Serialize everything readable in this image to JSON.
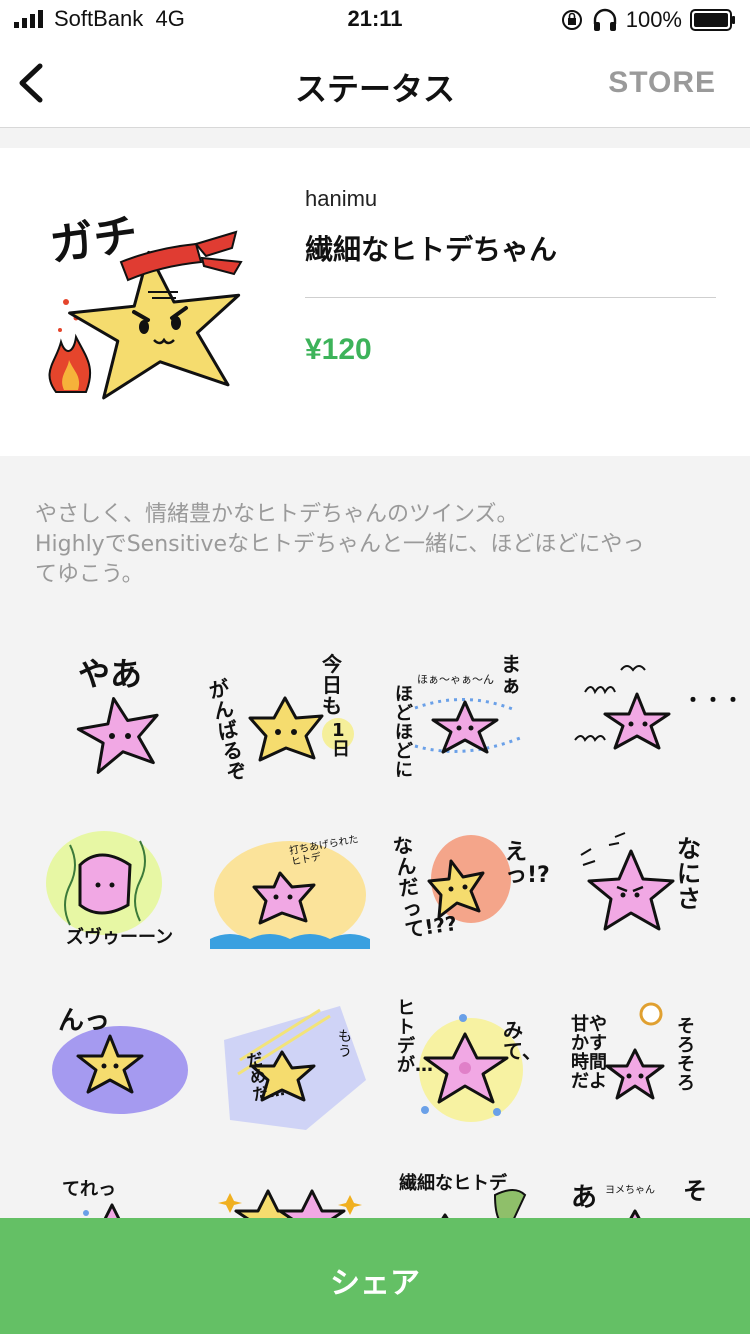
{
  "status_bar": {
    "carrier": "SoftBank",
    "network": "4G",
    "time": "21:11",
    "battery_percent": "100%"
  },
  "nav": {
    "back_icon": "chevron-left-icon",
    "title": "ステータス",
    "store_label": "STORE"
  },
  "product": {
    "author": "hanimu",
    "name": "繊細なヒトデちゃん",
    "price": "¥120",
    "main_sticker_text": "ガチ"
  },
  "description": {
    "line1": "やさしく、情緒豊かなヒトデちゃんのツインズ。",
    "line2": "HighlyでSensitiveなヒトデちゃんと一緒に、ほどほどにやっ",
    "line3": "てゆこう。"
  },
  "stickers": {
    "s1": {
      "text": "やあ"
    },
    "s2": {
      "text_a": "がんばるぞ",
      "text_b": "今日も",
      "text_c": "1日"
    },
    "s3": {
      "text_a": "まぁ",
      "text_b": "ほどほどに",
      "text_c": "ほぁ〜ゃぁ〜ん"
    },
    "s4": {
      "text": "・・・"
    },
    "s5": {
      "text": "ズヴゥーーン"
    },
    "s6": {
      "text": "打ちあげられたヒトデ"
    },
    "s7": {
      "text_a": "なんだって!??",
      "text_b": "えっ!?"
    },
    "s8": {
      "text": "なにさ"
    },
    "s9": {
      "text": "んっ"
    },
    "s10": {
      "text_a": "もう",
      "text_b": "だめだ…"
    },
    "s11": {
      "text_a": "ヒトデが…",
      "text_b": "みて、"
    },
    "s12": {
      "text_a": "甘やかす時間だよ",
      "text_b": "そろそろ"
    },
    "s13": {
      "text": "てれっ"
    },
    "s15": {
      "text": "繊細なヒトデ"
    },
    "s16": {
      "text": "あ"
    }
  },
  "share_label": "シェア",
  "colors": {
    "price_green": "#3db35a",
    "share_green": "#64c065",
    "star_yellow": "#f5dc6e",
    "star_pink": "#f1a8e4"
  }
}
